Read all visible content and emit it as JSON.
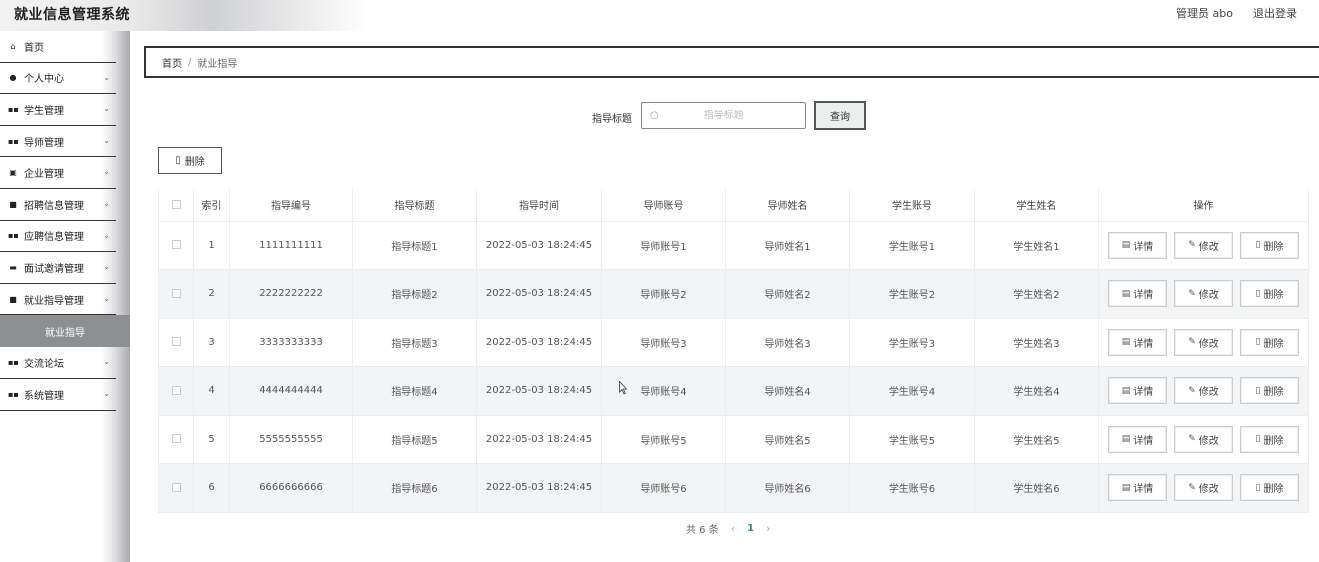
{
  "header": {
    "title": "就业信息管理系统",
    "admin_label": "管理员 abo",
    "logout_label": "退出登录"
  },
  "sidebar": {
    "items": [
      {
        "label": "首页",
        "icon": "home-icon",
        "glyph": "⌂",
        "arrow": false
      },
      {
        "label": "个人中心",
        "icon": "user-icon",
        "glyph": "●",
        "arrow": true
      },
      {
        "label": "学生管理",
        "icon": "grid-icon",
        "glyph": "▪▪",
        "arrow": true
      },
      {
        "label": "导师管理",
        "icon": "grid-icon",
        "glyph": "▪▪",
        "arrow": true
      },
      {
        "label": "企业管理",
        "icon": "box-icon",
        "glyph": "▣",
        "arrow": true
      },
      {
        "label": "招聘信息管理",
        "icon": "doc-icon",
        "glyph": "■",
        "arrow": true
      },
      {
        "label": "应聘信息管理",
        "icon": "grid-icon",
        "glyph": "▪▪",
        "arrow": true
      },
      {
        "label": "面试邀请管理",
        "icon": "chat-icon",
        "glyph": "▬",
        "arrow": true
      },
      {
        "label": "就业指导管理",
        "icon": "doc-icon",
        "glyph": "■",
        "arrow": true
      }
    ],
    "active_sub": "就业指导",
    "items_after": [
      {
        "label": "交流论坛",
        "icon": "grid-icon",
        "glyph": "▪▪",
        "arrow": true
      },
      {
        "label": "系统管理",
        "icon": "grid-icon",
        "glyph": "▪▪",
        "arrow": true
      }
    ]
  },
  "breadcrumb": {
    "home": "首页",
    "separator": "/",
    "current": "就业指导"
  },
  "search": {
    "label": "指导标题",
    "placeholder": "指导标题",
    "button": "查询"
  },
  "toolbar": {
    "delete_label": "删除"
  },
  "table": {
    "headers": [
      "索引",
      "指导编号",
      "指导标题",
      "指导时间",
      "导师账号",
      "导师姓名",
      "学生账号",
      "学生姓名",
      "操作"
    ],
    "rows": [
      {
        "index": "1",
        "code": "1111111111",
        "title": "指导标题1",
        "time": "2022-05-03 18:24:45",
        "tutor_account": "导师账号1",
        "tutor_name": "导师姓名1",
        "student_account": "学生账号1",
        "student_name": "学生姓名1"
      },
      {
        "index": "2",
        "code": "2222222222",
        "title": "指导标题2",
        "time": "2022-05-03 18:24:45",
        "tutor_account": "导师账号2",
        "tutor_name": "导师姓名2",
        "student_account": "学生账号2",
        "student_name": "学生姓名2"
      },
      {
        "index": "3",
        "code": "3333333333",
        "title": "指导标题3",
        "time": "2022-05-03 18:24:45",
        "tutor_account": "导师账号3",
        "tutor_name": "导师姓名3",
        "student_account": "学生账号3",
        "student_name": "学生姓名3"
      },
      {
        "index": "4",
        "code": "4444444444",
        "title": "指导标题4",
        "time": "2022-05-03 18:24:45",
        "tutor_account": "导师账号4",
        "tutor_name": "导师姓名4",
        "student_account": "学生账号4",
        "student_name": "学生姓名4"
      },
      {
        "index": "5",
        "code": "5555555555",
        "title": "指导标题5",
        "time": "2022-05-03 18:24:45",
        "tutor_account": "导师账号5",
        "tutor_name": "导师姓名5",
        "student_account": "学生账号5",
        "student_name": "学生姓名5"
      },
      {
        "index": "6",
        "code": "6666666666",
        "title": "指导标题6",
        "time": "2022-05-03 18:24:45",
        "tutor_account": "导师账号6",
        "tutor_name": "导师姓名6",
        "student_account": "学生账号6",
        "student_name": "学生姓名6"
      }
    ],
    "actions": {
      "detail": "详情",
      "edit": "修改",
      "delete": "删除"
    }
  },
  "pagination": {
    "total_text": "共 6 条",
    "current_page": "1"
  }
}
